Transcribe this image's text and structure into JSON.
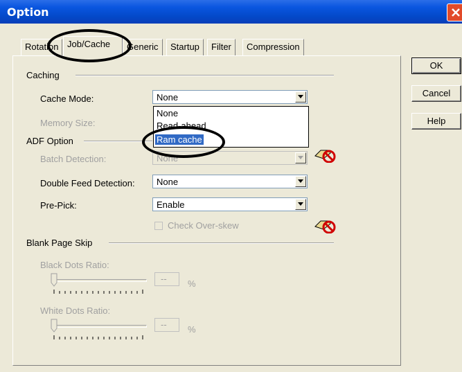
{
  "window": {
    "title": "Option"
  },
  "tabs": [
    "Rotation",
    "Job/Cache",
    "Generic",
    "Startup",
    "Filter",
    "Compression"
  ],
  "buttons": {
    "ok": "OK",
    "cancel": "Cancel",
    "help": "Help"
  },
  "caching": {
    "group_label": "Caching",
    "cache_mode_label": "Cache Mode:",
    "cache_mode_value": "None",
    "memory_size_label": "Memory Size:",
    "dropdown_options": [
      "None",
      "Read-ahead",
      "Ram cache"
    ],
    "dropdown_selected": "Ram cache"
  },
  "adf": {
    "group_label": "ADF Option",
    "batch_detection_label": "Batch Detection:",
    "batch_detection_value": "None",
    "double_feed_label": "Double Feed Detection:",
    "double_feed_value": "None",
    "pre_pick_label": "Pre-Pick:",
    "pre_pick_value": "Enable",
    "check_overskew_label": "Check Over-skew"
  },
  "blank_page": {
    "group_label": "Blank Page Skip",
    "black_dots_label": "Black Dots Ratio:",
    "black_dots_value": "--",
    "white_dots_label": "White Dots Ratio:",
    "white_dots_value": "--",
    "unit": "%"
  },
  "icons": {
    "close": "close-icon",
    "unavailable": "no-drop-hand-icon",
    "dropdown": "chevron-down-icon"
  },
  "colors": {
    "titlebar": "#0349c9",
    "selection": "#316ac5",
    "dialog": "#ece9d8"
  }
}
